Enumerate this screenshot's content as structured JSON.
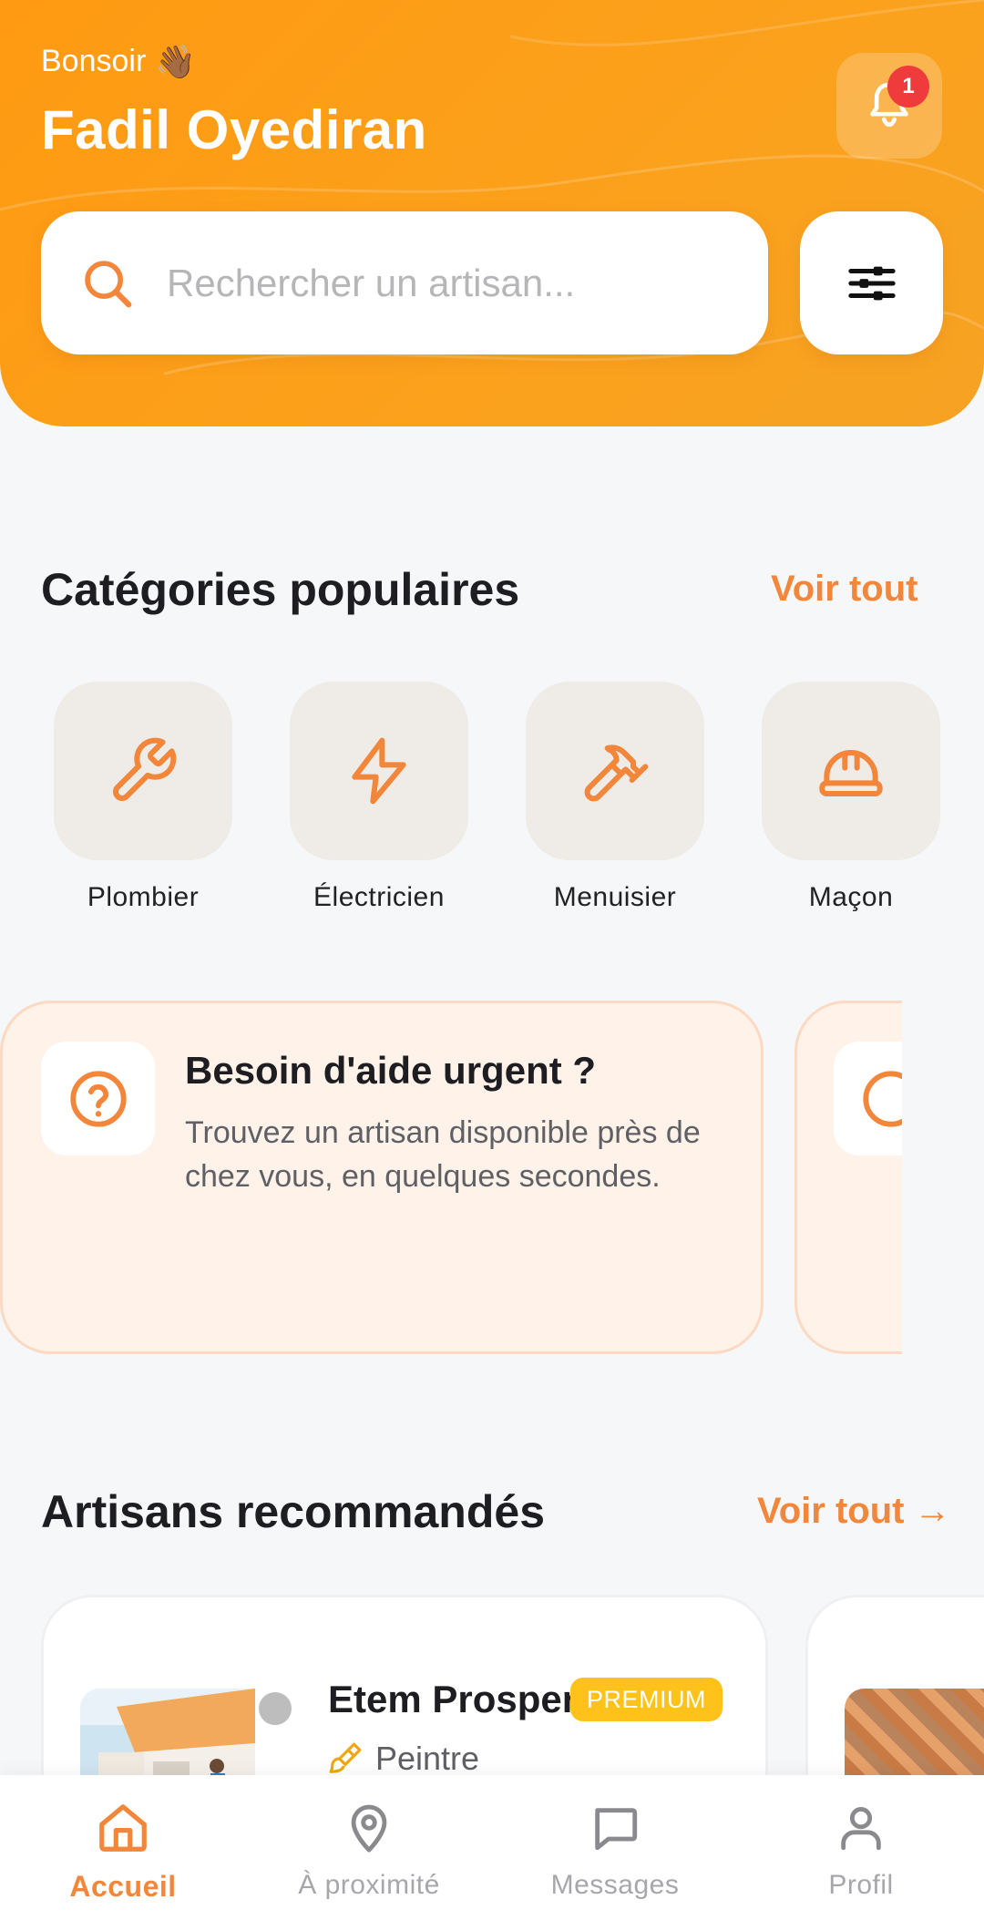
{
  "header": {
    "greeting": "Bonsoir",
    "greeting_emoji": "👋🏾",
    "user_name": "Fadil Oyediran",
    "notification_count": "1",
    "accent": "#ff9a12"
  },
  "search": {
    "placeholder": "Rechercher un artisan..."
  },
  "categories": {
    "title": "Catégories populaires",
    "see_all": "Voir tout",
    "items": [
      {
        "label": "Plombier",
        "icon": "wrench-icon"
      },
      {
        "label": "Électricien",
        "icon": "lightning-icon"
      },
      {
        "label": "Menuisier",
        "icon": "hammer-icon"
      },
      {
        "label": "Maçon",
        "icon": "hard-hat-icon"
      }
    ]
  },
  "help_card": {
    "title": "Besoin d'aide urgent ?",
    "text": "Trouvez un artisan disponible près de chez vous, en quelques secondes.",
    "icon": "question-circle-icon"
  },
  "artisans": {
    "title": "Artisans recommandés",
    "see_all": "Voir tout →",
    "items": [
      {
        "name": "Etem Prosper",
        "badge": "PREMIUM",
        "job": "Peintre",
        "job_icon": "paintbrush-icon"
      }
    ]
  },
  "bottom_nav": {
    "items": [
      {
        "label": "Accueil",
        "icon": "home-icon",
        "active": true
      },
      {
        "label": "À proximité",
        "icon": "location-pin-icon",
        "active": false
      },
      {
        "label": "Messages",
        "icon": "chat-bubble-icon",
        "active": false
      },
      {
        "label": "Profil",
        "icon": "user-icon",
        "active": false
      }
    ]
  }
}
